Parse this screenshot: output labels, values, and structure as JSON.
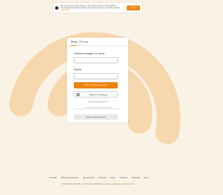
{
  "colors": {
    "accent": "#ee8208",
    "background": "#fbf2e6",
    "pattern": "#f7d7ad"
  },
  "cookie_banner": {
    "text": "Мы используем cookie-файлы, чтобы сделать работу сайта удобнее. Продолжая пользоваться сайтом, вы соглашаетесь на их использование.",
    "link": "Подробнее",
    "button": "Хорошо"
  },
  "auth": {
    "tabs": [
      {
        "label": "Вход",
        "active": true
      },
      {
        "label": "QR-код",
        "active": false
      }
    ],
    "login": {
      "label": "Телефон или адрес эл. почты",
      "value": "",
      "placeholder": ""
    },
    "password": {
      "label": "Пароль",
      "value": "",
      "placeholder": ""
    },
    "submit": "Войти в Одноклассники",
    "qr_button": "Войти по QR-коду",
    "forgot": "Не получается войти?",
    "divider": "Нет профиля в Одноклассниках",
    "register": "Зарегистрироваться"
  },
  "footer": {
    "lang": "Русский",
    "links": [
      "Мобильная версия",
      "Для бизнеса",
      "Помощь",
      "Игры",
      "Подарки",
      "Реклама",
      "Ещё"
    ],
    "copyright": "© 2006–2024 ООО «ВК», 12+",
    "policy_text": "Политика обработки и защиты данных в",
    "policy_brand": "Одноклассниках"
  }
}
